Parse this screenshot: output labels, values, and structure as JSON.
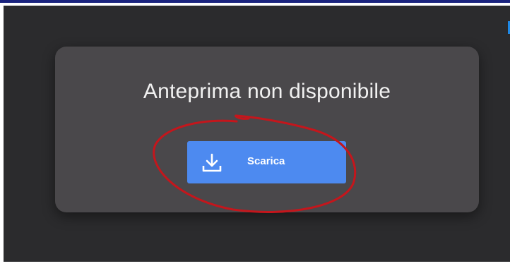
{
  "message": {
    "title": "Anteprima non disponibile"
  },
  "download_button": {
    "label": "Scarica",
    "icon": "download-icon",
    "color": "#4d8af0"
  },
  "annotation": {
    "color": "#c4161c"
  },
  "colors": {
    "viewer_background": "#2b2b2d",
    "card_background": "#4a484b",
    "text": "#f1f1f1"
  }
}
